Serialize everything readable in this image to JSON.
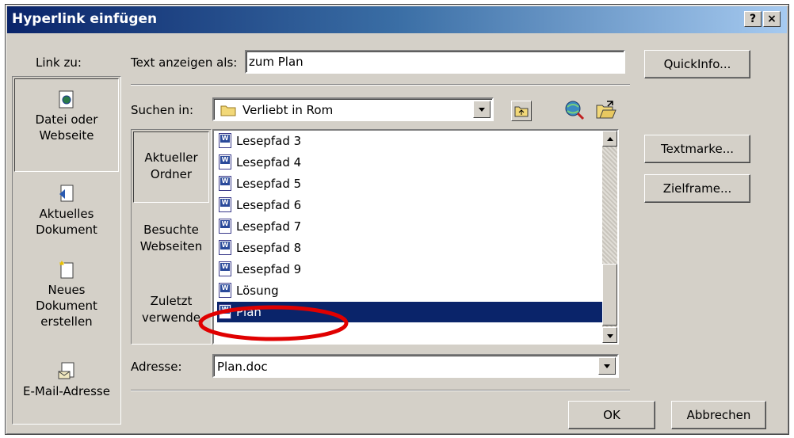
{
  "dialog": {
    "title": "Hyperlink einfügen",
    "help_glyph": "?",
    "close_glyph": "×"
  },
  "link_to": {
    "label": "Link zu:",
    "items": [
      {
        "label_line1": "Datei oder",
        "label_line2": "Webseite",
        "icon": "file-web-icon",
        "selected": true
      },
      {
        "label_line1": "Aktuelles",
        "label_line2": "Dokument",
        "icon": "current-document-icon",
        "selected": false
      },
      {
        "label_line1": "Neues",
        "label_line2": "Dokument",
        "label_line3": "erstellen",
        "icon": "new-document-icon",
        "selected": false
      },
      {
        "label_line1": "E-Mail-Adresse",
        "icon": "email-icon",
        "selected": false
      }
    ]
  },
  "display_text": {
    "label": "Text anzeigen als:",
    "value": "zum Plan"
  },
  "quickinfo_button": "QuickInfo...",
  "look_in": {
    "label": "Suchen in:",
    "value": "Verliebt in Rom",
    "icon": "folder-icon"
  },
  "toolbar_icons": [
    "up-folder-icon",
    "browse-web-icon",
    "browse-file-icon"
  ],
  "places": [
    {
      "line1": "Aktueller",
      "line2": "Ordner",
      "selected": true
    },
    {
      "line1": "Besuchte",
      "line2": "Webseiten",
      "selected": false
    },
    {
      "line1": "Zuletzt",
      "line2": "verwende",
      "selected": false
    }
  ],
  "files": [
    {
      "name": "Lesepfad 3",
      "selected": false
    },
    {
      "name": "Lesepfad 4",
      "selected": false
    },
    {
      "name": "Lesepfad 5",
      "selected": false
    },
    {
      "name": "Lesepfad 6",
      "selected": false
    },
    {
      "name": "Lesepfad 7",
      "selected": false
    },
    {
      "name": "Lesepfad 8",
      "selected": false
    },
    {
      "name": "Lesepfad 9",
      "selected": false
    },
    {
      "name": "Lösung",
      "selected": false
    },
    {
      "name": "Plan",
      "selected": true
    }
  ],
  "side_buttons": {
    "bookmark": "Textmarke...",
    "target_frame": "Zielframe..."
  },
  "address": {
    "label": "Adresse:",
    "value": "Plan.doc"
  },
  "footer": {
    "ok": "OK",
    "cancel": "Abbrechen"
  },
  "colors": {
    "title_gradient_start": "#0a246a",
    "title_gradient_end": "#a6caf0",
    "selection": "#0a246a",
    "dialog_face": "#d4d0c8",
    "highlight_ellipse": "#e00000"
  }
}
